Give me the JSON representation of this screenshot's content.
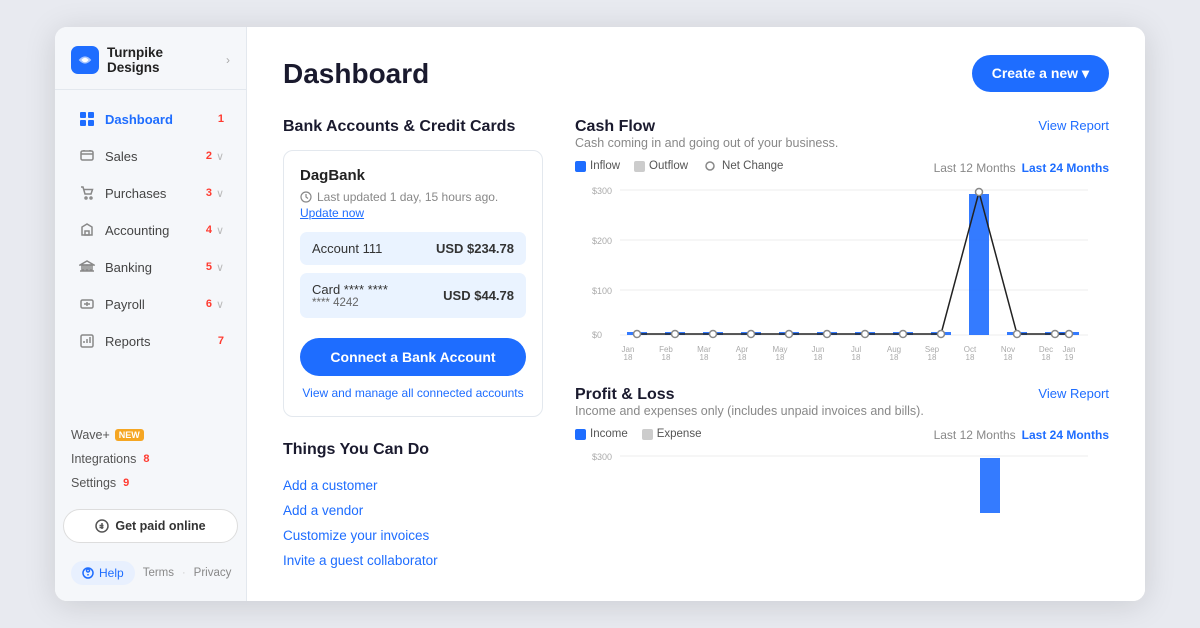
{
  "brand": {
    "name": "Turnpike Designs",
    "chevron": "›"
  },
  "nav": {
    "items": [
      {
        "id": "dashboard",
        "label": "Dashboard",
        "num": "1",
        "active": true,
        "hasChevron": false
      },
      {
        "id": "sales",
        "label": "Sales",
        "num": "2",
        "active": false,
        "hasChevron": true
      },
      {
        "id": "purchases",
        "label": "Purchases",
        "num": "3",
        "active": false,
        "hasChevron": true
      },
      {
        "id": "accounting",
        "label": "Accounting",
        "num": "4",
        "active": false,
        "hasChevron": true
      },
      {
        "id": "banking",
        "label": "Banking",
        "num": "5",
        "active": false,
        "hasChevron": true
      },
      {
        "id": "payroll",
        "label": "Payroll",
        "num": "6",
        "active": false,
        "hasChevron": true
      },
      {
        "id": "reports",
        "label": "Reports",
        "num": "7",
        "active": false,
        "hasChevron": false
      }
    ]
  },
  "sidebar_extra": {
    "wave_plus": "Wave+",
    "new_label": "NEW",
    "integrations": "Integrations",
    "integrations_num": "8",
    "settings": "Settings",
    "settings_num": "9"
  },
  "get_paid_btn": "Get paid online",
  "help_btn": "Help",
  "footer": {
    "terms": "Terms",
    "privacy": "Privacy",
    "dot": "·"
  },
  "page": {
    "title": "Dashboard",
    "create_btn": "Create a new ▾"
  },
  "bank_section": {
    "title": "Bank Accounts & Credit Cards",
    "bank_name": "DagBank",
    "updated_text": "Last updated 1 day, 15 hours ago.",
    "update_link": "Update now",
    "accounts": [
      {
        "label": "Account 111",
        "amount": "USD $234.78"
      },
      {
        "label": "Card **** ****",
        "label2": "**** 4242",
        "amount": "USD $44.78"
      }
    ],
    "connect_btn": "Connect a Bank Account",
    "view_link": "View and manage all connected accounts"
  },
  "things_section": {
    "title": "Things You Can Do",
    "links": [
      "Add a customer",
      "Add a vendor",
      "Customize your invoices",
      "Invite a guest collaborator"
    ]
  },
  "cashflow": {
    "title": "Cash Flow",
    "subtitle": "Cash coming in and going out of your business.",
    "view_report": "View Report",
    "legend": {
      "inflow": "Inflow",
      "outflow": "Outflow",
      "net_change": "Net Change"
    },
    "period_12": "Last 12 Months",
    "period_24": "Last 24 Months",
    "y_labels": [
      "$300",
      "$200",
      "$100",
      "$0"
    ],
    "x_labels": [
      "Jan\n18",
      "Feb\n18",
      "Mar\n18",
      "Apr\n18",
      "May\n18",
      "Jun\n18",
      "Jul\n18",
      "Aug\n18",
      "Sep\n18",
      "Oct\n18",
      "Nov\n18",
      "Dec\n18",
      "Jan\n19"
    ]
  },
  "profit_loss": {
    "title": "Profit & Loss",
    "subtitle": "Income and expenses only (includes unpaid invoices and bills).",
    "view_report": "View Report",
    "legend": {
      "income": "Income",
      "expense": "Expense"
    },
    "period_12": "Last 12 Months",
    "period_24": "Last 24 Months",
    "y_label": "$300"
  }
}
